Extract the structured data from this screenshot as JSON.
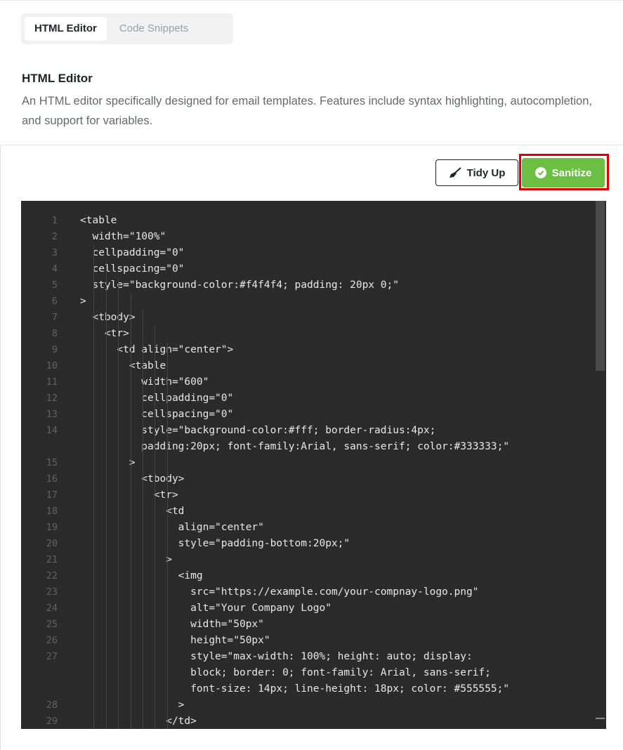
{
  "tabs": [
    {
      "label": "HTML Editor",
      "active": true
    },
    {
      "label": "Code Snippets",
      "active": false
    }
  ],
  "section": {
    "title": "HTML Editor",
    "description": "An HTML editor specifically designed for email templates. Features include syntax highlighting, autocompletion, and support for variables."
  },
  "toolbar": {
    "tidy_label": "Tidy Up",
    "tidy_icon": "broom-icon",
    "sanitize_label": "Sanitize",
    "sanitize_icon": "check-circle-icon"
  },
  "colors": {
    "accent_green": "#6bc043",
    "highlight_red": "#e00000",
    "editor_bg": "#2b2b2b"
  },
  "code": {
    "lines": [
      {
        "n": "1",
        "text": "<table"
      },
      {
        "n": "2",
        "text": "  width=\"100%\""
      },
      {
        "n": "3",
        "text": "  cellpadding=\"0\""
      },
      {
        "n": "4",
        "text": "  cellspacing=\"0\""
      },
      {
        "n": "5",
        "text": "  style=\"background-color:#f4f4f4; padding: 20px 0;\""
      },
      {
        "n": "6",
        "text": ">"
      },
      {
        "n": "7",
        "text": "  <tbody>"
      },
      {
        "n": "8",
        "text": "    <tr>"
      },
      {
        "n": "9",
        "text": "      <td align=\"center\">"
      },
      {
        "n": "10",
        "text": "        <table"
      },
      {
        "n": "11",
        "text": "          width=\"600\""
      },
      {
        "n": "12",
        "text": "          cellpadding=\"0\""
      },
      {
        "n": "13",
        "text": "          cellspacing=\"0\""
      },
      {
        "n": "14",
        "text": "          style=\"background-color:#fff; border-radius:4px;"
      },
      {
        "n": "",
        "text": "          padding:20px; font-family:Arial, sans-serif; color:#333333;\""
      },
      {
        "n": "15",
        "text": "        >"
      },
      {
        "n": "16",
        "text": "          <tbody>"
      },
      {
        "n": "17",
        "text": "            <tr>"
      },
      {
        "n": "18",
        "text": "              <td"
      },
      {
        "n": "19",
        "text": "                align=\"center\""
      },
      {
        "n": "20",
        "text": "                style=\"padding-bottom:20px;\""
      },
      {
        "n": "21",
        "text": "              >"
      },
      {
        "n": "22",
        "text": "                <img"
      },
      {
        "n": "23",
        "text": "                  src=\"https://example.com/your-compnay-logo.png\""
      },
      {
        "n": "24",
        "text": "                  alt=\"Your Company Logo\""
      },
      {
        "n": "25",
        "text": "                  width=\"50px\""
      },
      {
        "n": "26",
        "text": "                  height=\"50px\""
      },
      {
        "n": "27",
        "text": "                  style=\"max-width: 100%; height: auto; display:"
      },
      {
        "n": "",
        "text": "                  block; border: 0; font-family: Arial, sans-serif;"
      },
      {
        "n": "",
        "text": "                  font-size: 14px; line-height: 18px; color: #555555;\""
      },
      {
        "n": "28",
        "text": "                >"
      },
      {
        "n": "29",
        "text": "              </td>"
      }
    ]
  }
}
